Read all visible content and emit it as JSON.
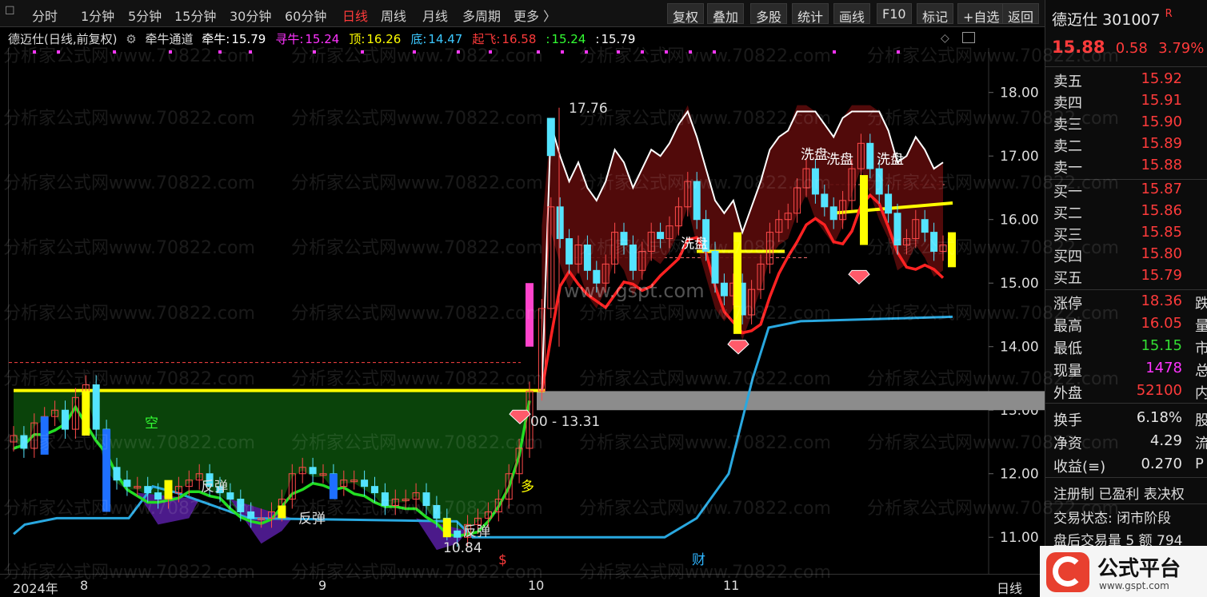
{
  "toolbar": {
    "periods": [
      "分时",
      "1分钟",
      "5分钟",
      "15分钟",
      "30分钟",
      "60分钟",
      "日线",
      "周线",
      "月线",
      "多周期",
      "更多 〉"
    ],
    "active": "日线",
    "right_buttons": [
      "复权",
      "叠加",
      "多股",
      "统计",
      "画线",
      "F10",
      "标记",
      "+自选",
      "返回"
    ]
  },
  "legend": {
    "title": "德迈仕(日线,前复权)",
    "indicator": "牵牛通道",
    "items": [
      {
        "label": "牵牛:",
        "value": "15.79",
        "color": "#ffffff"
      },
      {
        "label": "寻牛:",
        "value": "15.24",
        "color": "#ff33ff"
      },
      {
        "label": "顶:",
        "value": "16.26",
        "color": "#ffff00"
      },
      {
        "label": "底:",
        "value": "14.47",
        "color": "#3cc8ff"
      },
      {
        "label": "起飞:",
        "value": "16.58",
        "color": "#ff3b3b"
      },
      {
        "label": ":",
        "value": "15.24",
        "color": "#33ff33"
      },
      {
        "label": ":",
        "value": "15.79",
        "color": "#ffffff"
      }
    ]
  },
  "chart_data": {
    "type": "candlestick",
    "ylim": [
      10.5,
      18.6
    ],
    "y_ticks": [
      "18.00",
      "17.00",
      "16.00",
      "15.00",
      "14.00",
      "13.00",
      "12.00",
      "11.00"
    ],
    "x_labels": [
      "2024年",
      "8",
      "9",
      "10",
      "11"
    ],
    "period_label": "日线",
    "annotations": [
      "17.76",
      "10.84",
      "00 - 13.31",
      "空",
      "多",
      "反弹",
      "反弹",
      "反弹",
      "洗盘",
      "洗盘",
      "洗盘",
      "洗盘",
      "财",
      "$"
    ],
    "closes": [
      12.6,
      12.4,
      12.8,
      12.9,
      13.0,
      12.7,
      13.2,
      13.4,
      12.7,
      12.1,
      11.9,
      11.8,
      11.8,
      11.7,
      11.6,
      11.7,
      11.8,
      11.9,
      12.0,
      11.8,
      11.7,
      11.6,
      11.4,
      11.3,
      11.3,
      11.4,
      11.6,
      12.0,
      12.1,
      12.0,
      12.0,
      11.8,
      11.9,
      11.9,
      11.8,
      11.7,
      11.5,
      11.6,
      11.6,
      11.7,
      11.5,
      11.3,
      11.1,
      11.0,
      11.2,
      11.3,
      11.4,
      11.6,
      12.0,
      12.4,
      13.3,
      14.6,
      16.2,
      15.7,
      15.3,
      15.6,
      15.2,
      15.0,
      15.3,
      15.8,
      15.6,
      15.2,
      15.5,
      15.8,
      15.7,
      15.9,
      16.2,
      16.6,
      16.0,
      15.5,
      15.0,
      14.8,
      15.0,
      14.5,
      14.9,
      15.3,
      15.8,
      16.0,
      16.1,
      16.5,
      16.8,
      16.4,
      16.2,
      16.0,
      16.3,
      16.8,
      17.2,
      16.8,
      16.4,
      16.1,
      15.6,
      15.7,
      16.0,
      15.8,
      15.5,
      15.6
    ]
  },
  "right_panel": {
    "stock_name": "德迈仕",
    "stock_code": "301007",
    "badge": "R",
    "price": "15.88",
    "change": "0.58",
    "change_pct": "3.79%",
    "asks": [
      {
        "label": "卖五",
        "value": "15.92"
      },
      {
        "label": "卖四",
        "value": "15.91"
      },
      {
        "label": "卖三",
        "value": "15.90"
      },
      {
        "label": "卖二",
        "value": "15.89"
      },
      {
        "label": "卖一",
        "value": "15.88"
      }
    ],
    "bids": [
      {
        "label": "买一",
        "value": "15.87"
      },
      {
        "label": "买二",
        "value": "15.86"
      },
      {
        "label": "买三",
        "value": "15.85"
      },
      {
        "label": "买四",
        "value": "15.80"
      },
      {
        "label": "买五",
        "value": "15.79"
      }
    ],
    "stats": [
      {
        "label": "涨停",
        "value": "18.36",
        "color": "#ff3b3b",
        "tail": "跌"
      },
      {
        "label": "最高",
        "value": "16.05",
        "color": "#ff3b3b",
        "tail": "量"
      },
      {
        "label": "最低",
        "value": "15.15",
        "color": "#33dd33",
        "tail": "市"
      },
      {
        "label": "现量",
        "value": "1478",
        "color": "#ff33ff",
        "tail": "总"
      },
      {
        "label": "外盘",
        "value": "52100",
        "color": "#ff3b3b",
        "tail": "内"
      }
    ],
    "stats2": [
      {
        "label": "换手",
        "value": "6.18%",
        "tail": "股"
      },
      {
        "label": "净资",
        "value": "4.29",
        "tail": "流"
      },
      {
        "label": "收益(≡)",
        "value": "0.270",
        "tail": "P"
      }
    ],
    "tags": "注册制 已盈利 表决权",
    "trade_status": "交易状态: 闭市阶段",
    "after_hours": "盘后交易量 5 额 794"
  },
  "logo": {
    "title": "公式平台",
    "url": "www.gspt.com"
  },
  "watermarks": [
    "分析家公式网www.70822.com",
    "www.gspt.com"
  ]
}
